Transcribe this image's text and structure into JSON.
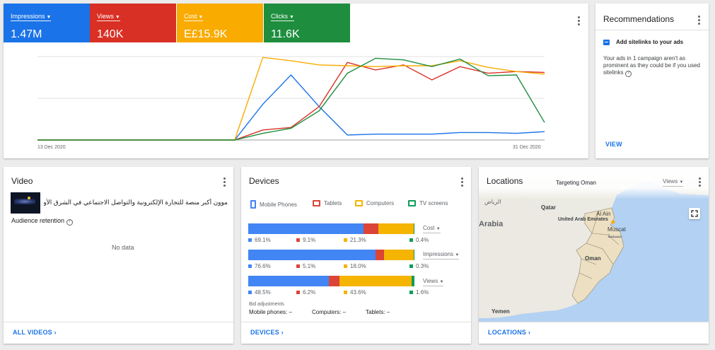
{
  "metrics": [
    {
      "label": "Impressions",
      "value": "1.47M",
      "color": "#1a73e8"
    },
    {
      "label": "Views",
      "value": "140K",
      "color": "#d93025"
    },
    {
      "label": "Cost",
      "value": "E£15.9K",
      "color": "#f9ab00"
    },
    {
      "label": "Clicks",
      "value": "11.6K",
      "color": "#1e8e3e"
    }
  ],
  "overview_chart": {
    "start_date": "13 Dec 2020",
    "end_date": "31 Dec 2020"
  },
  "chart_data": {
    "type": "line",
    "x": [
      "13 Dec 2020",
      "",
      "",
      "",
      "",
      "",
      "",
      "",
      "",
      "",
      "",
      "",
      "",
      "",
      "",
      "",
      "",
      "",
      "31 Dec 2020"
    ],
    "series": [
      {
        "name": "Impressions",
        "color": "#1a73e8",
        "values": [
          0,
          0,
          0,
          0,
          0,
          0,
          0,
          0,
          0.43,
          0.78,
          0.4,
          0.06,
          0.07,
          0.07,
          0.07,
          0.09,
          0.09,
          0.08,
          0.1
        ]
      },
      {
        "name": "Views",
        "color": "#d93025",
        "values": [
          0,
          0,
          0,
          0,
          0,
          0,
          0,
          0,
          0.12,
          0.15,
          0.4,
          0.93,
          0.84,
          0.9,
          0.72,
          0.88,
          0.8,
          0.82,
          0.81
        ]
      },
      {
        "name": "Cost",
        "color": "#f9ab00",
        "values": [
          0,
          0,
          0,
          0,
          0,
          0,
          0,
          0,
          0.99,
          0.95,
          0.9,
          0.89,
          0.88,
          0.89,
          0.89,
          0.95,
          0.87,
          0.82,
          0.79
        ]
      },
      {
        "name": "Clicks",
        "color": "#1e8e3e",
        "values": [
          0,
          0,
          0,
          0,
          0,
          0,
          0,
          0,
          0.08,
          0.14,
          0.35,
          0.8,
          0.98,
          0.96,
          0.88,
          0.97,
          0.77,
          0.78,
          0.21
        ]
      }
    ],
    "xlabel": "",
    "ylabel": "",
    "grid": true
  },
  "recommendations": {
    "title": "Recommendations",
    "item_title": "Add sitelinks to your ads",
    "item_body": "Your ads in 1 campaign aren't as prominent as they could be if you used sitelinks",
    "view_label": "VIEW"
  },
  "video": {
    "title": "Video",
    "video_title": "موون أكبر منصة للتجارة الإلكترونية والتواصل الاجتماعي في الشرق الأوسط",
    "retention_label": "Audience retention",
    "no_data": "No data",
    "footer": "ALL VIDEOS"
  },
  "devices": {
    "title": "Devices",
    "legend": [
      {
        "label": "Mobile Phones",
        "color": "#4285f4"
      },
      {
        "label": "Tablets",
        "color": "#db4437"
      },
      {
        "label": "Computers",
        "color": "#f4b400"
      },
      {
        "label": "TV screens",
        "color": "#0f9d58"
      }
    ],
    "rows": [
      {
        "metric": "Cost",
        "values": [
          69.1,
          9.1,
          21.3,
          0.4
        ],
        "labels": [
          "69.1%",
          "9.1%",
          "21.3%",
          "0.4%"
        ]
      },
      {
        "metric": "Impressions",
        "values": [
          76.6,
          5.1,
          18.0,
          0.3
        ],
        "labels": [
          "76.6%",
          "5.1%",
          "18.0%",
          "0.3%"
        ]
      },
      {
        "metric": "Views",
        "values": [
          48.5,
          6.2,
          43.6,
          1.6
        ],
        "labels": [
          "48.5%",
          "6.2%",
          "43.6%",
          "1.6%"
        ]
      }
    ],
    "bid_title": "Bid adjustments",
    "bid_mobile": "Mobile phones: –",
    "bid_computers": "Computers: –",
    "bid_tablets": "Tablets: –",
    "footer": "DEVICES"
  },
  "locations": {
    "title": "Locations",
    "targeting": "Targeting Oman",
    "metric": "Views",
    "footer": "LOCATIONS",
    "map_labels": {
      "qatar": "Qatar",
      "uae": "United Arab Emirates",
      "al_ain": "Al Ain",
      "muscat": "Muscat",
      "muscat_ar": "مسقط",
      "oman": "Oman",
      "arabia": "Arabia",
      "yemen": "Yemen",
      "riyadh_ar": "الرياض"
    }
  }
}
